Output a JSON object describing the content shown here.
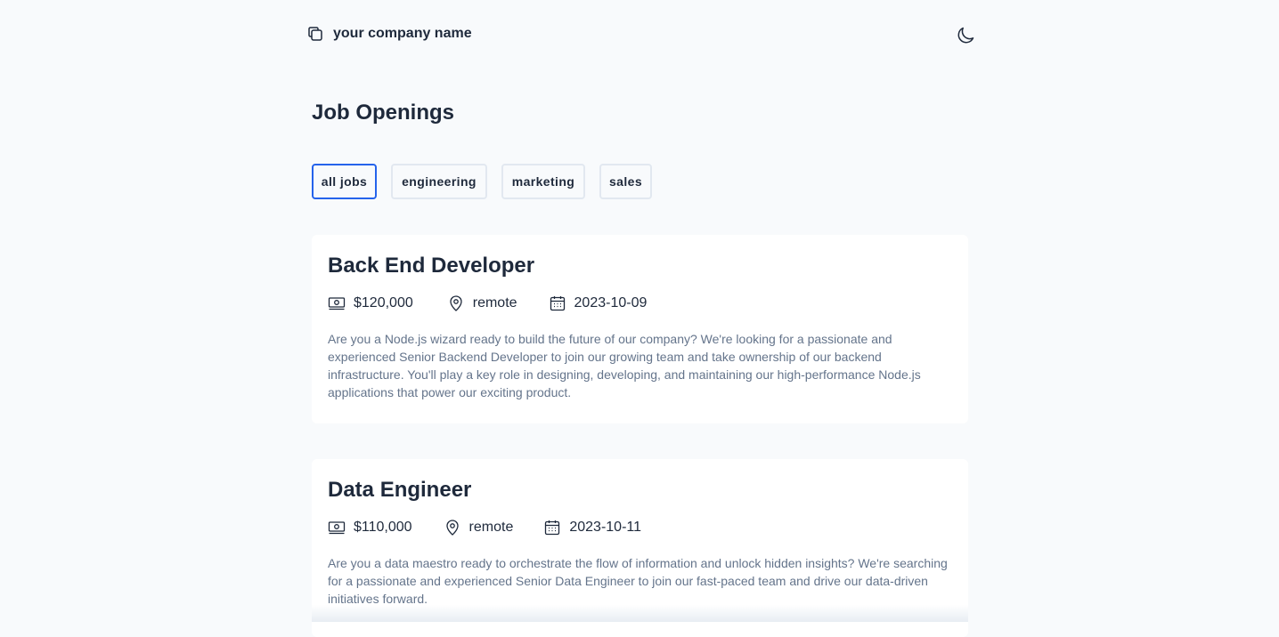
{
  "header": {
    "company_name": "your company name",
    "brand_icon": "copy-icon",
    "theme_icon": "moon-icon"
  },
  "page": {
    "title": "Job Openings"
  },
  "filters": [
    {
      "label": "all jobs",
      "active": true
    },
    {
      "label": "engineering",
      "active": false
    },
    {
      "label": "marketing",
      "active": false
    },
    {
      "label": "sales",
      "active": false
    }
  ],
  "jobs": [
    {
      "title": "Back End Developer",
      "salary": "$120,000",
      "location": "remote",
      "date": "2023-10-09",
      "description": "Are you a Node.js wizard ready to build the future of our company? We're looking for a passionate and experienced Senior Backend Developer to join our growing team and take ownership of our backend infrastructure. You'll play a key role in designing, developing, and maintaining our high-performance Node.js applications that power our exciting product."
    },
    {
      "title": "Data Engineer",
      "salary": "$110,000",
      "location": "remote",
      "date": "2023-10-11",
      "description": "Are you a data maestro ready to orchestrate the flow of information and unlock hidden insights? We're searching for a passionate and experienced Senior Data Engineer to join our fast-paced team and drive our data-driven initiatives forward."
    }
  ],
  "colors": {
    "accent": "#2563eb",
    "background": "#f8fafc",
    "card": "#ffffff",
    "text": "#1e293b",
    "muted": "#64748b"
  }
}
